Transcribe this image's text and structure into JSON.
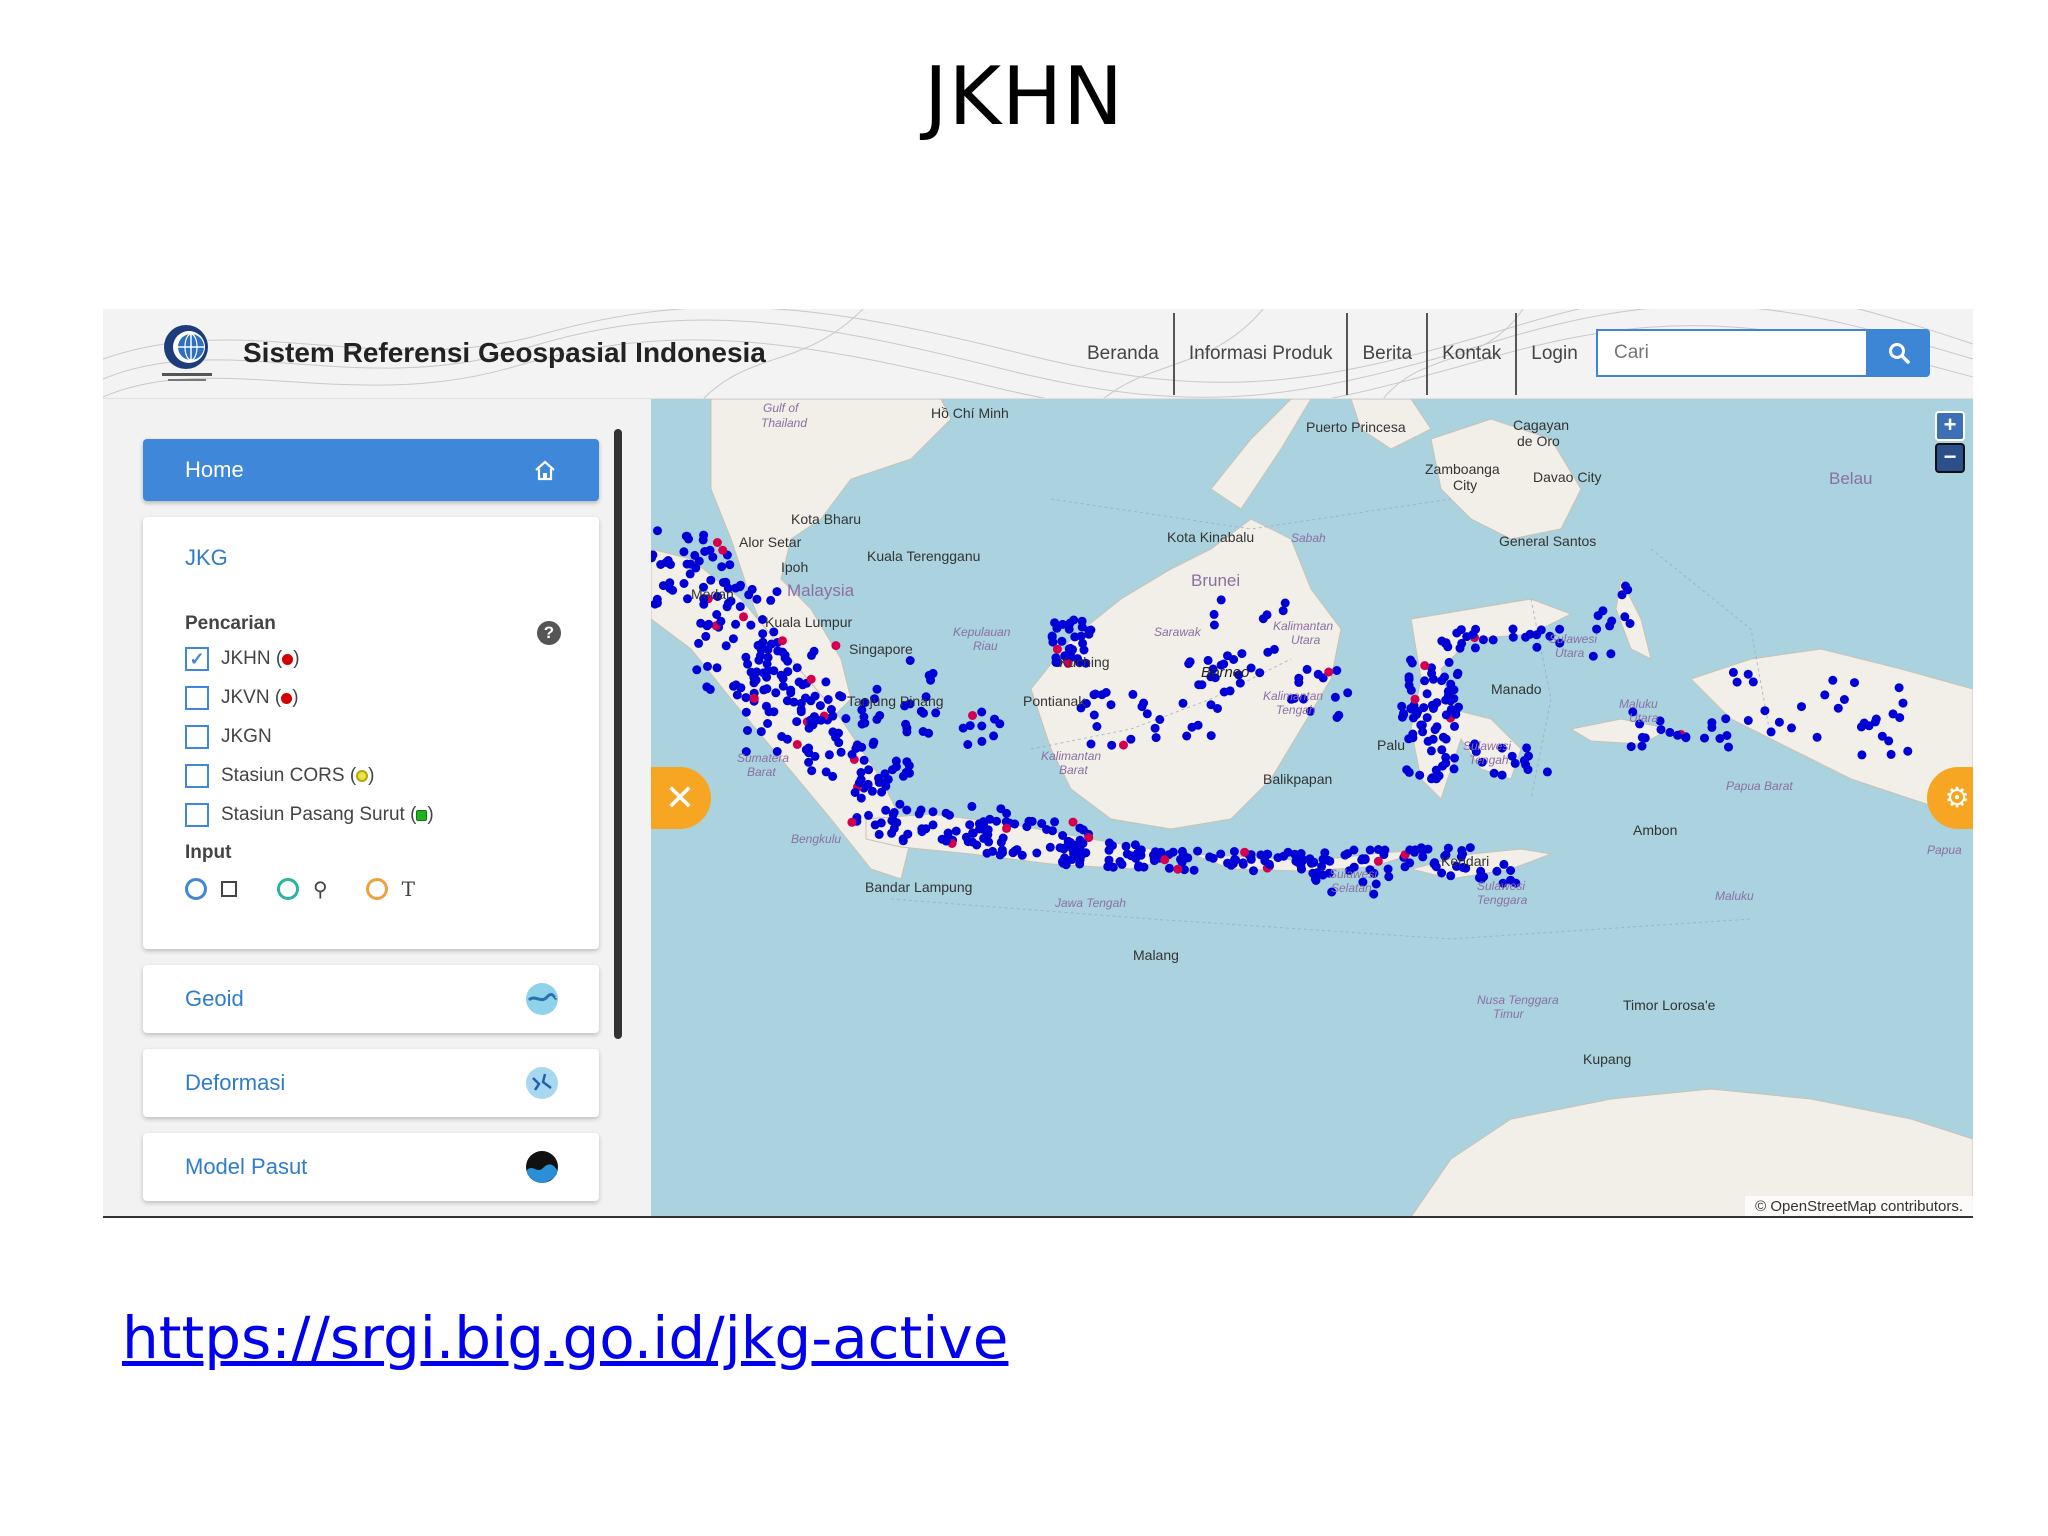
{
  "slide": {
    "title": "JKHN",
    "link": "https://srgi.big.go.id/jkg-active"
  },
  "header": {
    "logo_text": "BADAN INFORMASI GEOSPASIAL",
    "site_title": "Sistem Referensi Geospasial Indonesia",
    "nav": [
      "Beranda",
      "Informasi Produk",
      "Berita",
      "Kontak",
      "Login"
    ],
    "search_placeholder": "Cari",
    "search_icon": "search-icon"
  },
  "sidebar": {
    "home_label": "Home",
    "home_icon": "home-icon",
    "jkg": {
      "title": "JKG",
      "pencarian_label": "Pencarian",
      "help_icon": "?",
      "layers": [
        {
          "label": "JKHN (",
          "suffix": ")",
          "checked": true,
          "marker": "red-dot"
        },
        {
          "label": "JKVN (",
          "suffix": ")",
          "checked": false,
          "marker": "red-dot"
        },
        {
          "label": "JKGN",
          "suffix": "",
          "checked": false,
          "marker": ""
        },
        {
          "label": "Stasiun CORS (",
          "suffix": ")",
          "checked": false,
          "marker": "yellow-ring"
        },
        {
          "label": "Stasiun Pasang Surut (",
          "suffix": ")",
          "checked": false,
          "marker": "green-square"
        }
      ],
      "input_label": "Input",
      "input_glyphs": [
        "⚲",
        "T"
      ]
    },
    "cards": [
      {
        "title": "Geoid",
        "icon": "geoid-icon"
      },
      {
        "title": "Deformasi",
        "icon": "deformasi-icon"
      },
      {
        "title": "Model Pasut",
        "icon": "model-pasut-icon"
      }
    ]
  },
  "map": {
    "places": [
      "Gulf of",
      "Thailand",
      "Hồ Chí Minh",
      "Puerto Princesa",
      "Cagayan",
      "de Oro",
      "Zamboanga",
      "City",
      "Davao City",
      "Belau",
      "Kota Bharu",
      "Alor Setar",
      "Kuala Terengganu",
      "Ipoh",
      "Malaysia",
      "Kota Kinabalu",
      "Sabah",
      "General Santos",
      "Brunei",
      "Medan",
      "Kuala Lumpur",
      "Singapore",
      "Kepulauan",
      "Riau",
      "Kuching",
      "Sarawak",
      "Kalimantan",
      "Utara",
      "Borneo",
      "Tanjung Pinang",
      "Pontianak",
      "Sumatera",
      "Barat",
      "Kalimantan",
      "Barat",
      "Kalimantan",
      "Tengah",
      "Balikpapan",
      "Sulawesi",
      "Utara",
      "Manado",
      "Maluku",
      "Utara",
      "Sulawesi",
      "Tengah",
      "Palu",
      "Papua Barat",
      "Ambon",
      "Maluku",
      "Bengkulu",
      "Bandar Lampung",
      "Jawa Tengah",
      "Malang",
      "Sulawesi",
      "Selatan",
      "Kendari",
      "Sulawesi",
      "Tenggara",
      "Nusa Tenggara",
      "Timur",
      "Timor Lorosa'e",
      "Kupang",
      "Papua"
    ],
    "attribution": "© OpenStreetMap contributors.",
    "zoom_in": "+",
    "zoom_out": "−",
    "close_glyph": "✕",
    "settings_glyph": "⚙",
    "colors": {
      "sea": "#aad3df",
      "land": "#f2efe9",
      "jkhn_point": "#0000d6",
      "jkhn_red_point": "#d4004f",
      "accent": "#3f87d8",
      "fab": "#f6a623"
    }
  }
}
